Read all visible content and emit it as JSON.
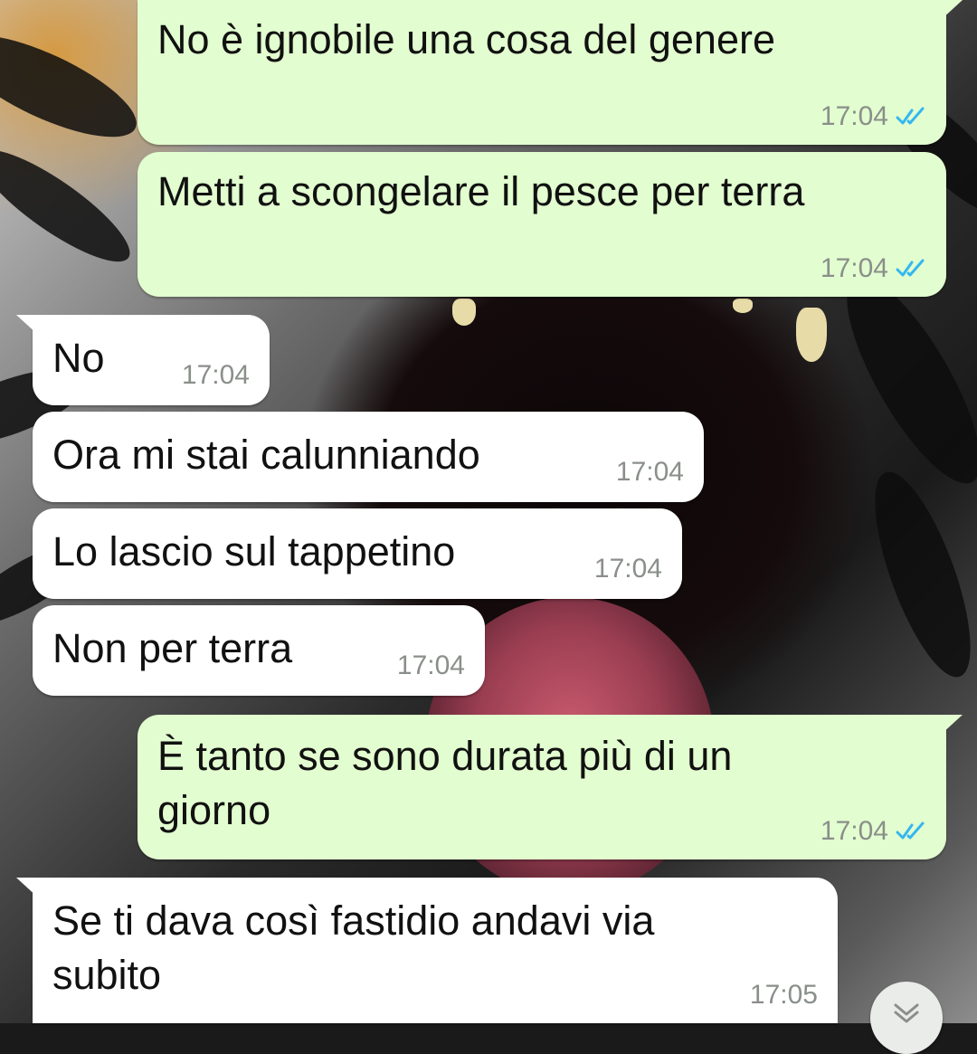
{
  "messages": [
    {
      "direction": "outgoing",
      "text": "No è ignobile una cosa del genere",
      "time": "17:04",
      "status": "read"
    },
    {
      "direction": "outgoing",
      "text": "Metti a scongelare il pesce per terra",
      "time": "17:04",
      "status": "read"
    },
    {
      "direction": "incoming",
      "text": "No",
      "time": "17:04"
    },
    {
      "direction": "incoming",
      "text": "Ora mi stai calunniando",
      "time": "17:04"
    },
    {
      "direction": "incoming",
      "text": "Lo lascio sul tappetino",
      "time": "17:04"
    },
    {
      "direction": "incoming",
      "text": "Non per terra",
      "time": "17:04"
    },
    {
      "direction": "outgoing",
      "text": "È tanto se sono durata più di un\ngiorno",
      "time": "17:04",
      "status": "read"
    },
    {
      "direction": "incoming",
      "text": "Se ti dava così fastidio andavi via\nsubito",
      "time": "17:05"
    }
  ],
  "icons": {
    "read_receipt": "double-check-icon",
    "scroll_down": "chevron-double-down-icon"
  },
  "colors": {
    "outgoing_bubble": "#e2fdcf",
    "incoming_bubble": "#ffffff",
    "read_check": "#34b7f1",
    "timestamp": "#8a8f8a"
  }
}
